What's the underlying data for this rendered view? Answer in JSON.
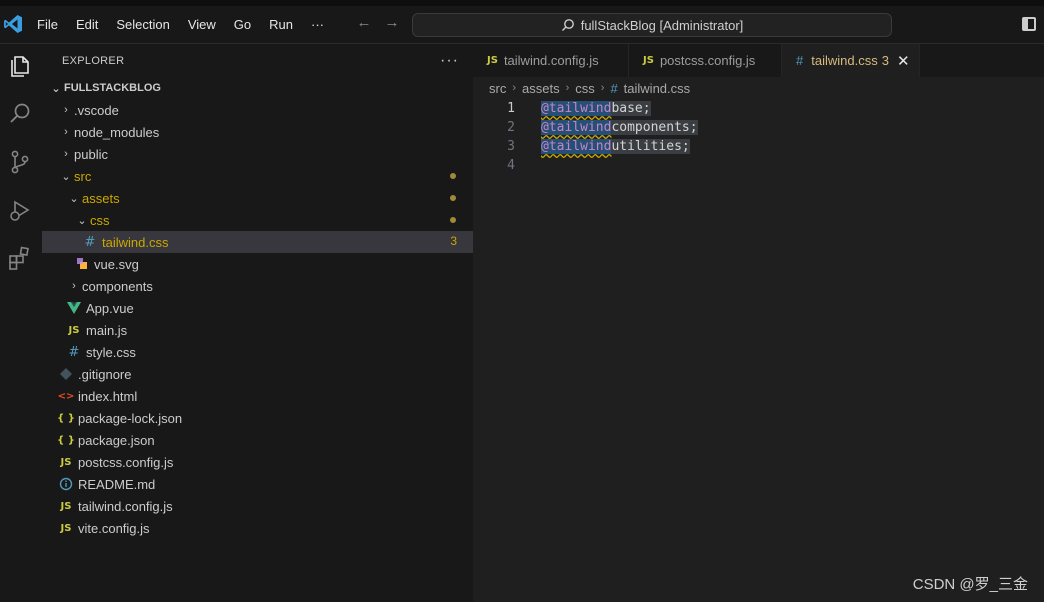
{
  "menubar": {
    "items": [
      "File",
      "Edit",
      "Selection",
      "View",
      "Go",
      "Run",
      "···"
    ]
  },
  "command_center": {
    "label": "fullStackBlog [Administrator]"
  },
  "explorer": {
    "header": "EXPLORER",
    "more": "···",
    "root": "FULLSTACKBLOG",
    "items": [
      {
        "label": ".vscode",
        "type": "folder",
        "depth": 0,
        "expanded": false
      },
      {
        "label": "node_modules",
        "type": "folder",
        "depth": 0,
        "expanded": false
      },
      {
        "label": "public",
        "type": "folder",
        "depth": 0,
        "expanded": false
      },
      {
        "label": "src",
        "type": "folder",
        "depth": 0,
        "expanded": true,
        "modified": true
      },
      {
        "label": "assets",
        "type": "folder",
        "depth": 1,
        "expanded": true,
        "modified": true
      },
      {
        "label": "css",
        "type": "folder",
        "depth": 2,
        "expanded": true,
        "modified": true
      },
      {
        "label": "tailwind.css",
        "type": "css",
        "depth": 3,
        "selected": true,
        "badge": "3"
      },
      {
        "label": "vue.svg",
        "type": "svg",
        "depth": 2
      },
      {
        "label": "components",
        "type": "folder",
        "depth": 1,
        "expanded": false
      },
      {
        "label": "App.vue",
        "type": "vue",
        "depth": 1
      },
      {
        "label": "main.js",
        "type": "js",
        "depth": 1
      },
      {
        "label": "style.css",
        "type": "css",
        "depth": 1
      },
      {
        "label": ".gitignore",
        "type": "git",
        "depth": 0
      },
      {
        "label": "index.html",
        "type": "html",
        "depth": 0
      },
      {
        "label": "package-lock.json",
        "type": "json",
        "depth": 0
      },
      {
        "label": "package.json",
        "type": "json",
        "depth": 0
      },
      {
        "label": "postcss.config.js",
        "type": "js",
        "depth": 0
      },
      {
        "label": "README.md",
        "type": "info",
        "depth": 0
      },
      {
        "label": "tailwind.config.js",
        "type": "js",
        "depth": 0
      },
      {
        "label": "vite.config.js",
        "type": "js",
        "depth": 0
      }
    ]
  },
  "tabs": [
    {
      "label": "tailwind.config.js",
      "icon": "JS"
    },
    {
      "label": "postcss.config.js",
      "icon": "JS"
    },
    {
      "label": "tailwind.css",
      "icon": "#",
      "badge": "3",
      "active": true,
      "close": "✕"
    }
  ],
  "breadcrumb": [
    "src",
    "assets",
    "css",
    "tailwind.css"
  ],
  "code": {
    "lines": [
      {
        "num": "1",
        "kw": "@tailwind",
        "val": " base;"
      },
      {
        "num": "2",
        "kw": "@tailwind",
        "val": " components;"
      },
      {
        "num": "3",
        "kw": "@tailwind",
        "val": " utilities;"
      },
      {
        "num": "4",
        "kw": "",
        "val": ""
      }
    ]
  },
  "icons": {
    "js": "JS",
    "css": "#",
    "json": "{ }",
    "html": "<>",
    "folder_collapsed": "›",
    "folder_expanded": "⌄"
  },
  "watermark": "CSDN @罗_三金",
  "colors": {
    "accent": "#0078d4",
    "modified": "#cca700",
    "js": "#cbcb41",
    "css": "#519aba",
    "vue": "#41b883",
    "html": "#e44d26"
  }
}
